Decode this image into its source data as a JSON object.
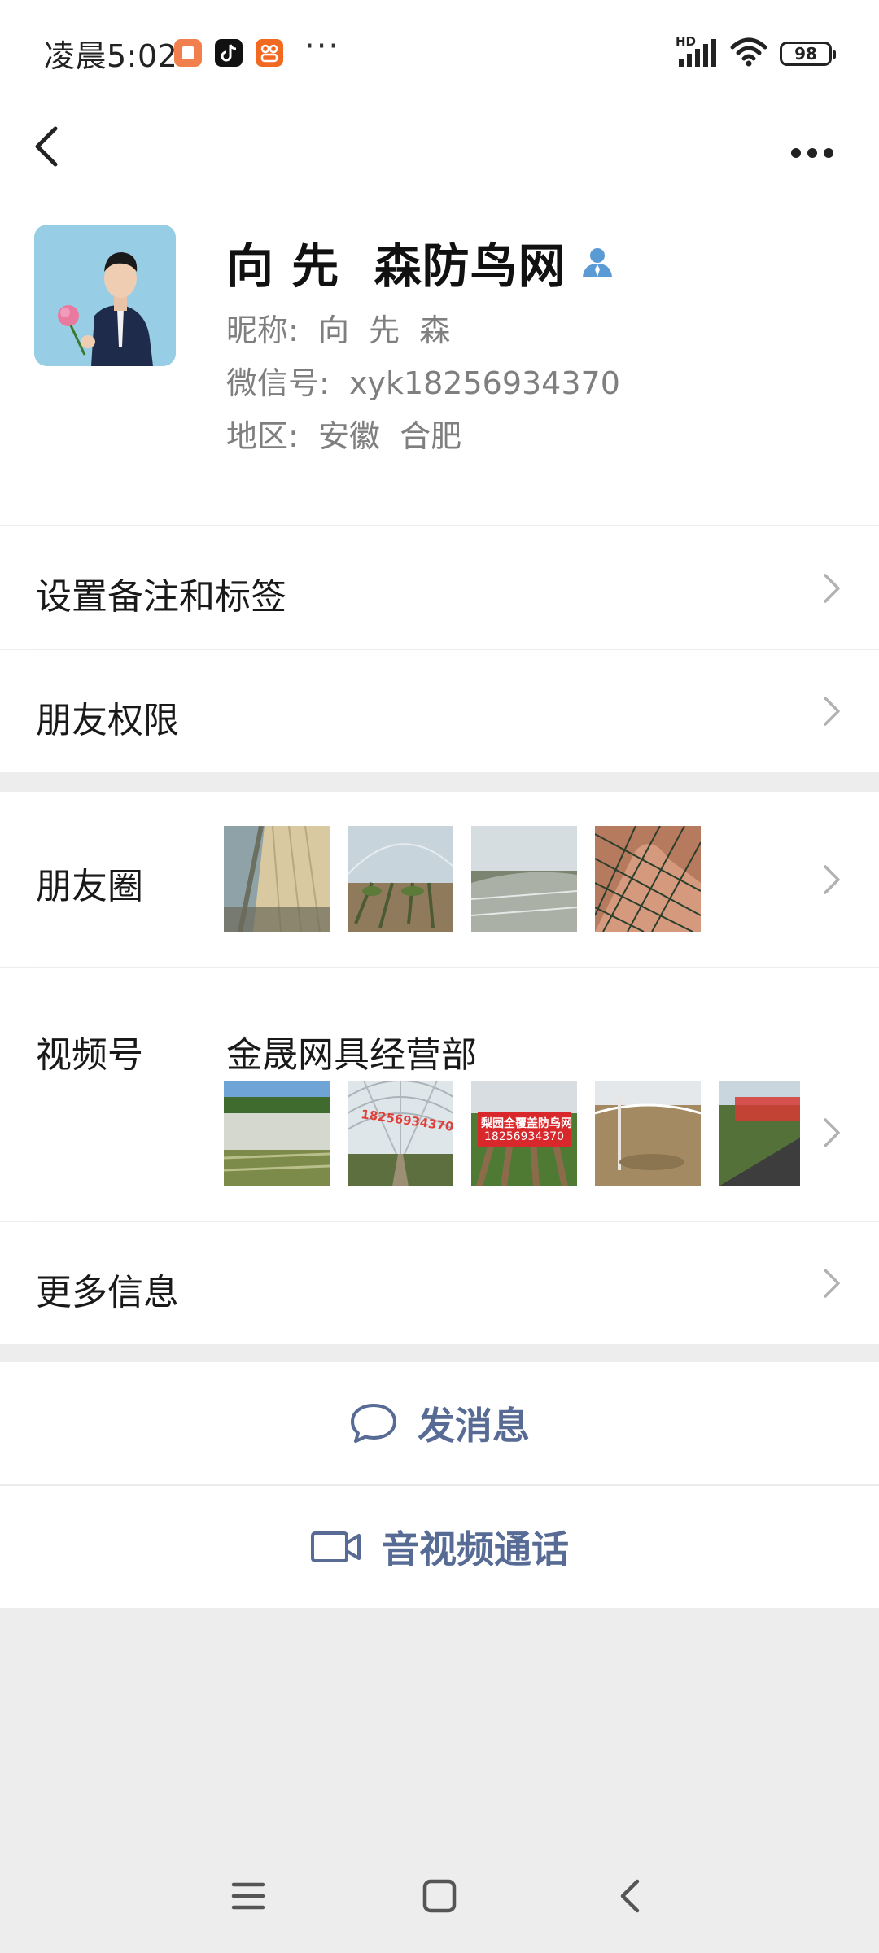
{
  "status_bar": {
    "time": "凌晨5:02",
    "more": "···",
    "network_label": "HD",
    "battery": "98",
    "apps": [
      "red-app-icon",
      "tiktok-icon",
      "orange-app-icon"
    ]
  },
  "header": {
    "back_icon": "chevron-left-icon",
    "more_icon": "more-horizontal-icon"
  },
  "profile": {
    "name": "向 先  森防鸟网",
    "nickname": "昵称:  向  先  森",
    "wechat_id": "微信号:  xyk18256934370",
    "region": "地区:  安徽  合肥"
  },
  "menu": {
    "remarks": "设置备注和标签",
    "permissions": "朋友权限",
    "moments": "朋友圈",
    "channels": "视频号",
    "channel_name": "金晟网具经营部",
    "more_info": "更多信息"
  },
  "channel_thumbs": {
    "t2_text": "18256934370",
    "t3_line1": "梨园全覆盖防鸟网",
    "t3_line2": "18256934370"
  },
  "actions": {
    "message": "发消息",
    "call": "音视频通话"
  },
  "colors": {
    "link": "#576b95",
    "background": "#ededed",
    "card": "#ffffff",
    "badge": "#5b9bd5"
  }
}
